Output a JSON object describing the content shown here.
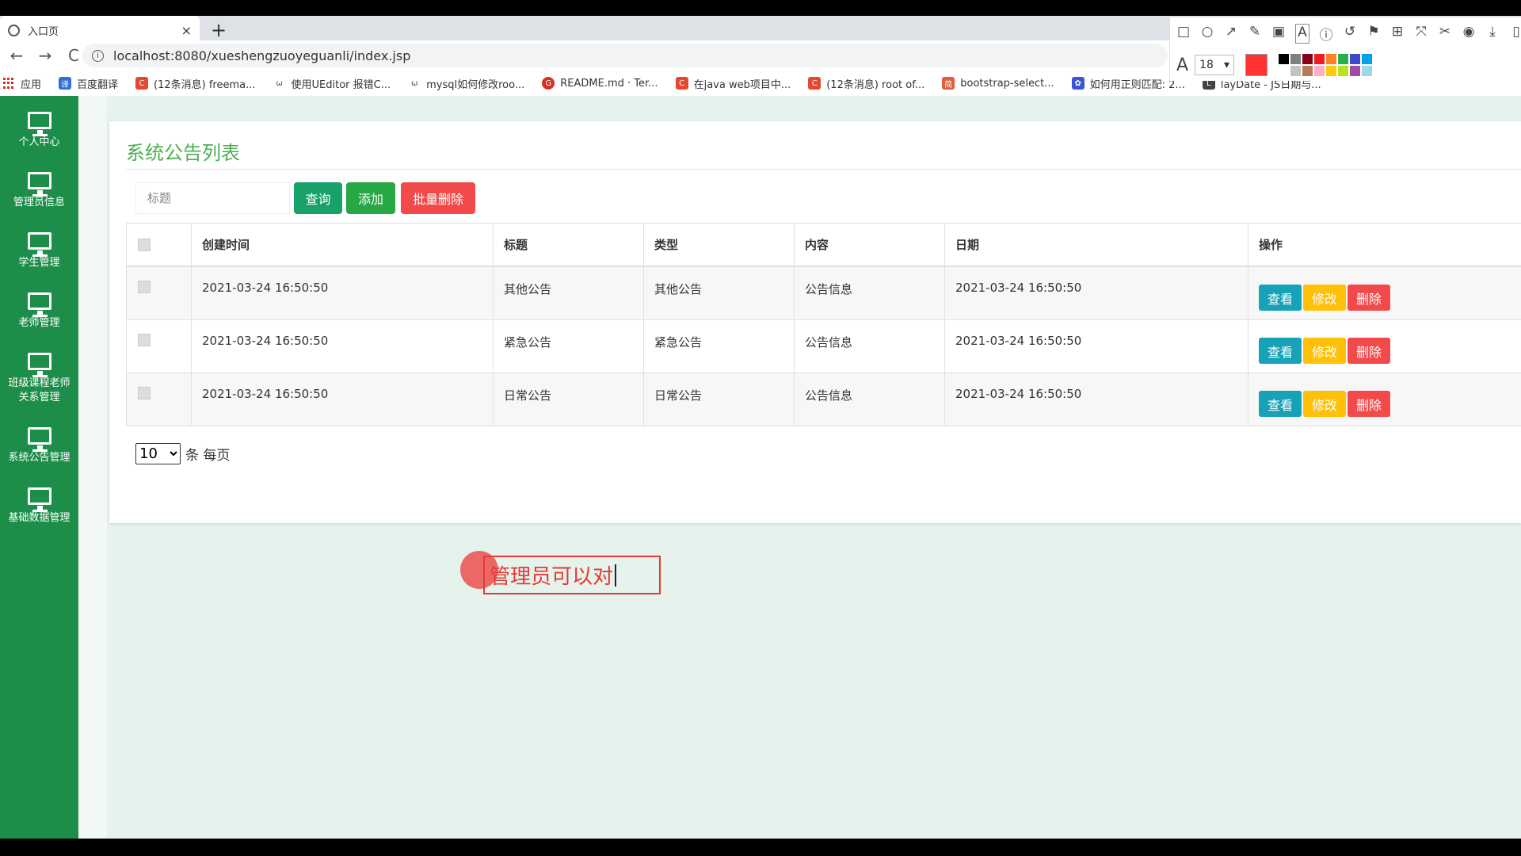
{
  "browser": {
    "tab_title": "入口页",
    "tab_close": "×",
    "new_tab": "+",
    "back": "←",
    "forward": "→",
    "reload": "C",
    "url": "localhost:8080/xueshengzuoyeguanli/index.jsp",
    "bookmarks": [
      {
        "label": "应用",
        "color": "#d93025"
      },
      {
        "label": "百度翻译",
        "color": "#2f6fd6"
      },
      {
        "label": "(12条消息) freema...",
        "color": "#e5482e"
      },
      {
        "label": "使用UEditor 报错C...",
        "color": "#555555"
      },
      {
        "label": "mysql如何修改roo...",
        "color": "#555555"
      },
      {
        "label": "README.md · Ter...",
        "color": "#d93025"
      },
      {
        "label": "在java web项目中...",
        "color": "#e5482e"
      },
      {
        "label": "(12条消息) root of...",
        "color": "#e5482e"
      },
      {
        "label": "bootstrap-select...",
        "color": "#e05c3a"
      },
      {
        "label": "如何用正则匹配: 2...",
        "color": "#3a56d4"
      },
      {
        "label": "layDate - JS日期与...",
        "color": "#444444"
      }
    ]
  },
  "annotation_toolbar": {
    "font_size": "18",
    "current_color": "#ff3333",
    "palette": [
      "#000000",
      "#7f7f7f",
      "#880015",
      "#ed1c24",
      "#ff7f27",
      "#22b14c",
      "#3f48cc",
      "#00a2e8",
      "#ffffff",
      "#c3c3c3",
      "#b97a57",
      "#ffaec9",
      "#ffc90e",
      "#b5e61d",
      "#a349a4",
      "#99d9ea"
    ]
  },
  "sidebar": {
    "items": [
      {
        "label": "个人中心"
      },
      {
        "label": "管理员信息"
      },
      {
        "label": "学生管理"
      },
      {
        "label": "老师管理"
      },
      {
        "label": "班级课程老师关系管理"
      },
      {
        "label": "系统公告管理"
      },
      {
        "label": "基础数据管理"
      }
    ]
  },
  "main": {
    "title": "系统公告列表",
    "search_placeholder": "标题",
    "query_label": "查询",
    "add_label": "添加",
    "batch_delete_label": "批量删除",
    "columns": [
      "创建时间",
      "标题",
      "类型",
      "内容",
      "日期",
      "操作"
    ],
    "rows": [
      {
        "created": "2021-03-24 16:50:50",
        "title": "其他公告",
        "type": "其他公告",
        "content": "公告信息",
        "date": "2021-03-24 16:50:50"
      },
      {
        "created": "2021-03-24 16:50:50",
        "title": "紧急公告",
        "type": "紧急公告",
        "content": "公告信息",
        "date": "2021-03-24 16:50:50"
      },
      {
        "created": "2021-03-24 16:50:50",
        "title": "日常公告",
        "type": "日常公告",
        "content": "公告信息",
        "date": "2021-03-24 16:50:50"
      }
    ],
    "actions": {
      "view": "查看",
      "edit": "修改",
      "delete": "删除"
    },
    "page_size": "10",
    "page_size_suffix": "条 每页"
  },
  "annotation_text": "管理员可以对"
}
